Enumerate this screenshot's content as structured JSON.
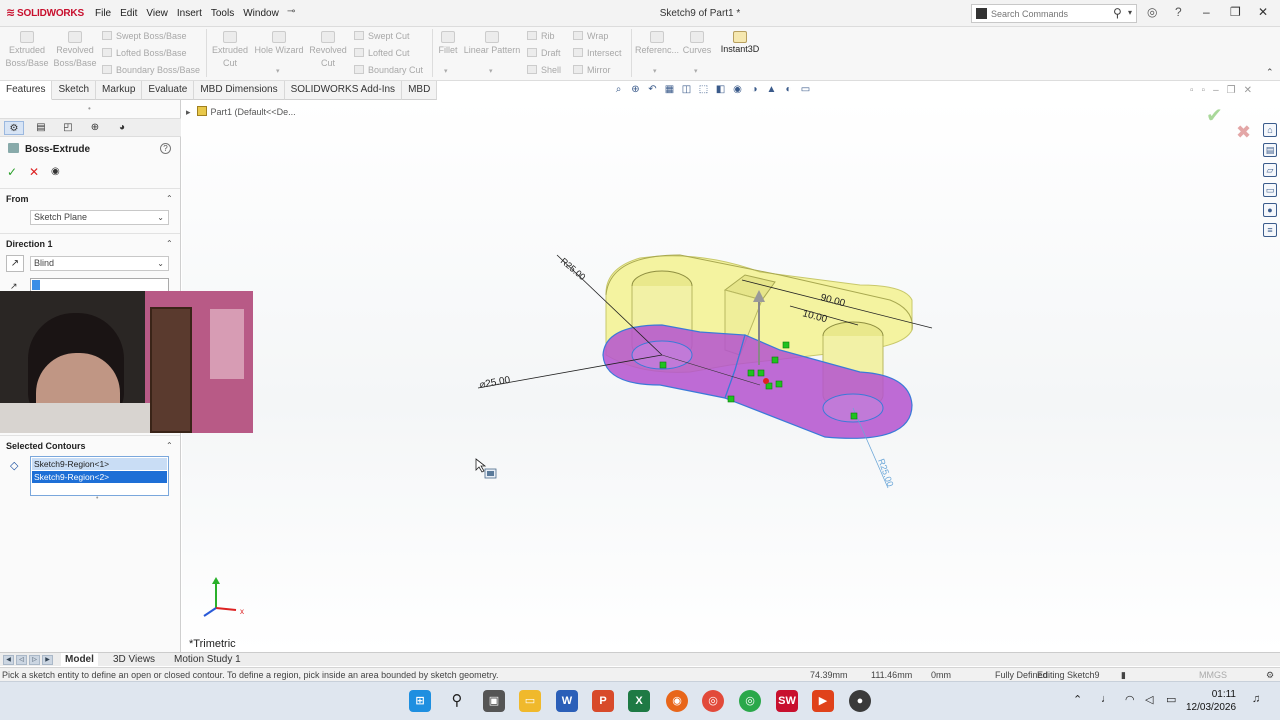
{
  "app": {
    "logo_text": "SOLIDWORKS",
    "menus": [
      "File",
      "Edit",
      "View",
      "Insert",
      "Tools",
      "Window"
    ],
    "document_title": "Sketch9 of Part1 *",
    "search_placeholder": "Search Commands"
  },
  "command_manager": {
    "extruded_boss": "Extruded Boss/Base",
    "revolved_boss": "Revolved Boss/Base",
    "swept_boss": "Swept Boss/Base",
    "lofted_boss": "Lofted Boss/Base",
    "boundary_boss": "Boundary Boss/Base",
    "extruded_cut": "Extruded Cut",
    "hole_wizard": "Hole Wizard",
    "revolved_cut": "Revolved Cut",
    "swept_cut": "Swept Cut",
    "lofted_cut": "Lofted Cut",
    "boundary_cut": "Boundary Cut",
    "fillet": "Fillet",
    "linear_pattern": "Linear Pattern",
    "rib": "Rib",
    "draft": "Draft",
    "shell": "Shell",
    "wrap": "Wrap",
    "intersect": "Intersect",
    "mirror": "Mirror",
    "reference": "Referenc...",
    "curves": "Curves",
    "instant3d": "Instant3D"
  },
  "tabs": [
    "Features",
    "Sketch",
    "Markup",
    "Evaluate",
    "MBD Dimensions",
    "SOLIDWORKS Add-Ins",
    "MBD"
  ],
  "property_manager": {
    "title": "Boss-Extrude",
    "from_label": "From",
    "from_value": "Sketch Plane",
    "direction_label": "Direction 1",
    "end_condition": "Blind",
    "selected_contours_label": "Selected Contours",
    "contours": [
      "Sketch9-Region<1>",
      "Sketch9-Region<2>"
    ]
  },
  "graphics": {
    "tree_flyout": "Part1  (Default<<De...",
    "view_orientation": "*Trimetric",
    "dimensions": [
      "R25.00",
      "90.00",
      "10.00",
      "⌀25.00",
      "R25.00"
    ]
  },
  "bottom_tabs": [
    "Model",
    "3D Views",
    "Motion Study 1"
  ],
  "status": {
    "message": "Pick a sketch entity to define an open or closed contour. To define a region, pick inside an area bounded by sketch geometry.",
    "x": "74.39mm",
    "y": "111.46mm",
    "z": "0mm",
    "sketch_state": "Fully Defined",
    "editing": "Editing Sketch9",
    "units": "MMGS"
  },
  "taskbar": {
    "time": "01:11",
    "date": "12/03/2026"
  },
  "colors": {
    "part_face": "#f4f3a0",
    "selected_region": "#b452cf",
    "accent_blue": "#1e6fd6",
    "logo_red": "#c8102e"
  }
}
